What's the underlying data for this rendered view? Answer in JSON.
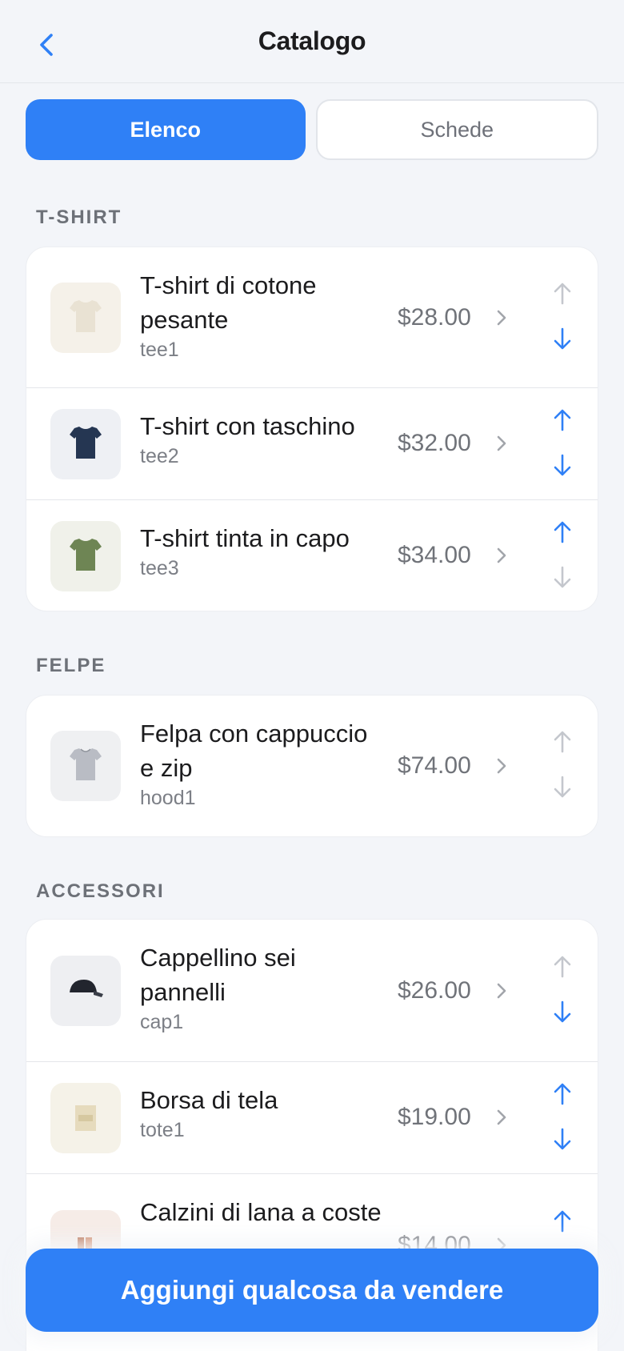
{
  "header": {
    "title": "Catalogo",
    "back_icon": "chevron-left-icon"
  },
  "tabs": [
    {
      "label": "Elenco",
      "selected": true
    },
    {
      "label": "Schede",
      "selected": false
    }
  ],
  "sections": [
    {
      "title": "T-SHIRT",
      "items": [
        {
          "name": "T-shirt di cotone pesante",
          "sku": "tee1",
          "price": "$28.00",
          "icon": "tshirt-icon",
          "thumb_color": "#e9e2d3",
          "thumb_bg": "#f5f1e9",
          "up_enabled": false,
          "down_enabled": true
        },
        {
          "name": "T-shirt con taschino",
          "sku": "tee2",
          "price": "$32.00",
          "icon": "tshirt-icon",
          "thumb_color": "#253652",
          "thumb_bg": "#eef0f4",
          "up_enabled": true,
          "down_enabled": true
        },
        {
          "name": "T-shirt tinta in capo",
          "sku": "tee3",
          "price": "$34.00",
          "icon": "tshirt-icon",
          "thumb_color": "#6e8554",
          "thumb_bg": "#f0f1ea",
          "up_enabled": true,
          "down_enabled": false
        }
      ]
    },
    {
      "title": "FELPE",
      "items": [
        {
          "name": "Felpa con cappuccio e zip",
          "sku": "hood1",
          "price": "$74.00",
          "icon": "hoodie-icon",
          "thumb_color": "#b9bcc4",
          "thumb_bg": "#eff0f2",
          "up_enabled": false,
          "down_enabled": false
        }
      ]
    },
    {
      "title": "ACCESSORI",
      "items": [
        {
          "name": "Cappellino sei pannelli",
          "sku": "cap1",
          "price": "$26.00",
          "icon": "cap-icon",
          "thumb_color": "#22252e",
          "thumb_bg": "#eeeff2",
          "up_enabled": false,
          "down_enabled": true
        },
        {
          "name": "Borsa di tela",
          "sku": "tote1",
          "price": "$19.00",
          "icon": "tote-bag-icon",
          "thumb_color": "#e6dbbd",
          "thumb_bg": "#f5f2e8",
          "up_enabled": true,
          "down_enabled": true
        },
        {
          "name": "Calzini di lana a coste",
          "sku": "",
          "price": "$14.00",
          "icon": "socks-icon",
          "thumb_color": "#b76b4a",
          "thumb_bg": "#f6ece7",
          "up_enabled": true,
          "down_enabled": false
        }
      ]
    }
  ],
  "cta": {
    "label": "Aggiungi qualcosa da vendere"
  },
  "colors": {
    "accent": "#2f80f6",
    "disabled_arrow": "#c4c7cd",
    "price_text": "#707379"
  }
}
